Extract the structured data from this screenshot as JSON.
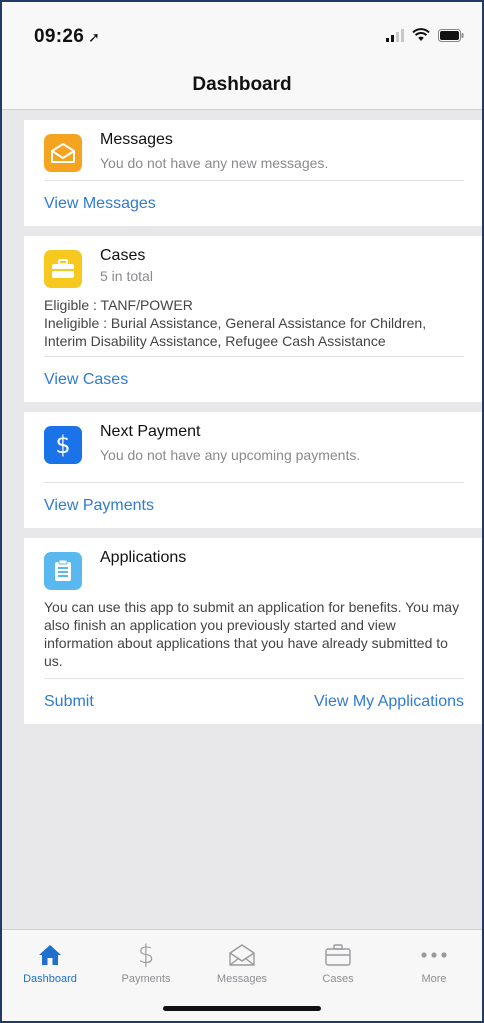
{
  "status_bar": {
    "time": "09:26",
    "location_icon": "location-arrow-icon",
    "icons": [
      "cellular-signal-icon",
      "wifi-icon",
      "battery-icon"
    ]
  },
  "nav": {
    "title": "Dashboard"
  },
  "cards": {
    "messages": {
      "title": "Messages",
      "subtitle": "You do not have any new messages.",
      "action": "View Messages",
      "icon": "envelope-icon",
      "color": "#f5a41f"
    },
    "cases": {
      "title": "Cases",
      "subtitle": "5 in total",
      "body": [
        "Eligible : TANF/POWER",
        "Ineligible : Burial Assistance, General Assistance for Children, Interim Disability Assistance, Refugee Cash Assistance"
      ],
      "action": "View Cases",
      "icon": "briefcase-icon",
      "color": "#f7c81e"
    },
    "payment": {
      "title": "Next Payment",
      "subtitle": "You do not have any upcoming payments.",
      "action": "View Payments",
      "icon": "dollar-icon",
      "color": "#1a73e8"
    },
    "applications": {
      "title": "Applications",
      "body": "You can use this app to submit an application for benefits. You may also finish an application you previously started and view information about applications that you have already submitted to us.",
      "action_left": "Submit",
      "action_right": "View My Applications",
      "icon": "clipboard-icon",
      "color": "#5ab8f0"
    }
  },
  "tabs": [
    {
      "label": "Dashboard",
      "icon": "home-icon",
      "active": true
    },
    {
      "label": "Payments",
      "icon": "dollar-icon",
      "active": false
    },
    {
      "label": "Messages",
      "icon": "envelope-icon",
      "active": false
    },
    {
      "label": "Cases",
      "icon": "briefcase-icon",
      "active": false
    },
    {
      "label": "More",
      "icon": "more-dots-icon",
      "active": false
    }
  ],
  "colors": {
    "accent": "#2f7bd3",
    "active_tab": "#1f6fcf",
    "inactive_tab": "#8e8e93"
  }
}
